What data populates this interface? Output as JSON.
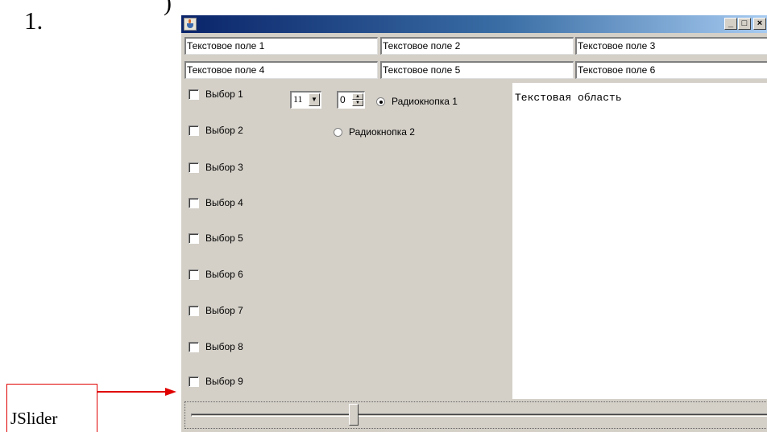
{
  "page": {
    "number": "1.",
    "paren": ")"
  },
  "callout": {
    "label": "JSlider",
    "color": "#e00000"
  },
  "window": {
    "titlebar": {
      "icon": "java-cup-icon",
      "buttons": [
        "_",
        "□",
        "×"
      ]
    },
    "text_fields": [
      "Текстовое поле 1",
      "Текстовое поле 2",
      "Текстовое поле 3",
      "Текстовое поле 4",
      "Текстовое поле 5",
      "Текстовое поле 6"
    ],
    "checkboxes": [
      {
        "label": "Выбор 1",
        "checked": false
      },
      {
        "label": "Выбор 2",
        "checked": false
      },
      {
        "label": "Выбор 3",
        "checked": false
      },
      {
        "label": "Выбор 4",
        "checked": false
      },
      {
        "label": "Выбор 5",
        "checked": false
      },
      {
        "label": "Выбор 6",
        "checked": false
      },
      {
        "label": "Выбор 7",
        "checked": false
      },
      {
        "label": "Выбор 8",
        "checked": false
      },
      {
        "label": "Выбор 9",
        "checked": false
      }
    ],
    "combo": {
      "value": "11"
    },
    "spinner": {
      "value": "0"
    },
    "radios": [
      {
        "label": "Радиокнопка 1",
        "selected": true
      },
      {
        "label": "Радиокнопка 2",
        "selected": false
      }
    ],
    "textarea": {
      "text": "Текстовая область"
    },
    "slider": {
      "value_fraction": 0.28
    }
  }
}
